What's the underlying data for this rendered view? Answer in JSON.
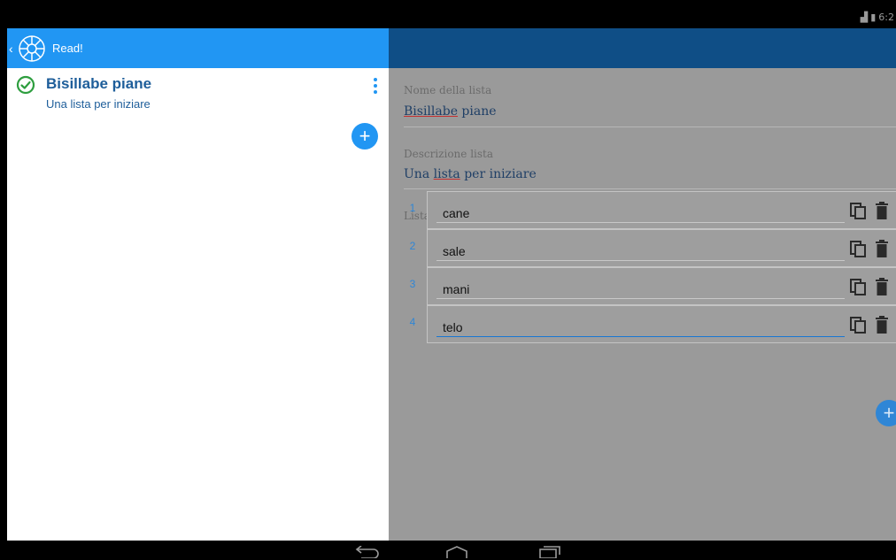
{
  "status": {
    "clock": "6:2"
  },
  "app": {
    "title": "Read!"
  },
  "lists": [
    {
      "title": "Bisillabe piane",
      "description": "Una lista per iniziare"
    }
  ],
  "detail": {
    "name_label": "Nome della lista",
    "name_value_1": "Bisillabe",
    "name_value_2": " piane",
    "desc_label": "Descrizione lista",
    "desc_value_1": "Una ",
    "desc_value_2": "lista",
    "desc_value_3": " per iniziare",
    "list_label": "Lista",
    "items": [
      {
        "num": "1",
        "text": "cane"
      },
      {
        "num": "2",
        "text": "sale"
      },
      {
        "num": "3",
        "text": "mani"
      },
      {
        "num": "4",
        "text": "telo"
      }
    ]
  },
  "icons": {
    "logo": "wheel-logo-icon",
    "check": "check-circle-icon",
    "copy": "copy-icon",
    "trash": "trash-icon",
    "add": "plus-icon"
  },
  "colors": {
    "primary": "#2196f3",
    "primary_dark": "#0f4e86",
    "item_title": "#1e5e9a",
    "check_green": "#2e9e3f",
    "overlay": "#9a9a9a"
  }
}
